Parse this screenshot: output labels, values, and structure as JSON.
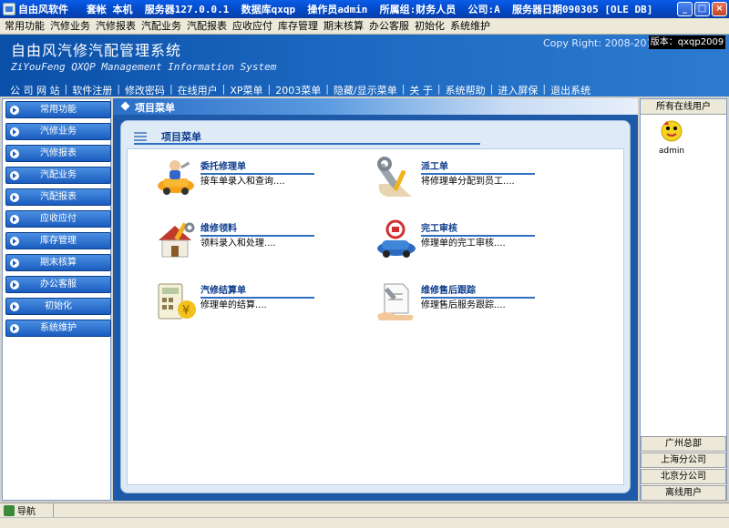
{
  "titlebar": {
    "text": "自由风软件   套帐 本机  服务器127.0.0.1  数据库qxqp  操作员admin  所属组:财务人员  公司:A  服务器日期090305 [OLE DB]"
  },
  "menubar": [
    "常用功能",
    "汽修业务",
    "汽修报表",
    "汽配业务",
    "汽配报表",
    "应收应付",
    "库存管理",
    "期末核算",
    "办公客服",
    "初始化",
    "系统维护"
  ],
  "banner": {
    "title": "自由风汽修汽配管理系统",
    "subtitle": "ZiYouFeng QXQP Management Information System",
    "copyright": "Copy Right: 2008-2010",
    "version": "版本：qxqp2009"
  },
  "topnav": [
    "公 司 网 站",
    "软件注册",
    "修改密码",
    "在线用户",
    "XP菜单",
    "2003菜单",
    "隐藏/显示菜单",
    "关 于",
    "系统帮助",
    "进入屏保",
    "退出系统"
  ],
  "sidebar": [
    "常用功能",
    "汽修业务",
    "汽修报表",
    "汽配业务",
    "汽配报表",
    "应收应付",
    "库存管理",
    "期末核算",
    "办公客服",
    "初始化",
    "系统维护"
  ],
  "main": {
    "tab_title": "项目菜单",
    "panel_title": "项目菜单",
    "features": [
      {
        "title": "委托修理单",
        "desc": "接车单录入和查询....",
        "icon": "car-repair-icon"
      },
      {
        "title": "派工单",
        "desc": "将修理单分配到员工....",
        "icon": "wrench-icon"
      },
      {
        "title": "维修领料",
        "desc": "领料录入和处理....",
        "icon": "house-tools-icon"
      },
      {
        "title": "完工审核",
        "desc": "修理单的完工审核....",
        "icon": "inspection-car-icon"
      },
      {
        "title": "汽修结算单",
        "desc": "修理单的结算....",
        "icon": "calculator-icon"
      },
      {
        "title": "维修售后跟踪",
        "desc": "修理售后服务跟踪....",
        "icon": "service-followup-icon"
      }
    ]
  },
  "right": {
    "header": "所有在线用户",
    "user": "admin",
    "branches": [
      "广州总部",
      "上海分公司",
      "北京分公司",
      "离线用户"
    ]
  },
  "status": {
    "label": "导航"
  },
  "colors": {
    "accent": "#1e5aa8",
    "title_blue": "#0c3c8c"
  }
}
